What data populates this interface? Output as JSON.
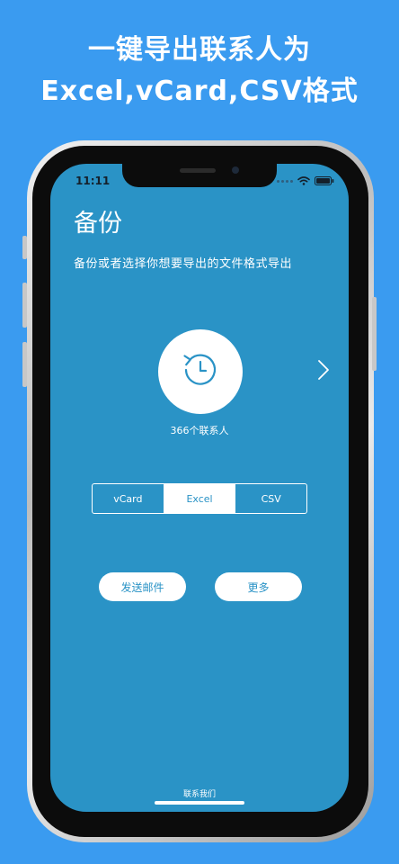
{
  "promo": {
    "line1": "一键导出联系人为",
    "line2": "Excel,vCard,CSV格式"
  },
  "status_bar": {
    "time": "11:11"
  },
  "screen": {
    "title": "备份",
    "subtitle": "备份或者选择你想要导出的文件格式导出",
    "contact_count": "366个联系人",
    "formats": [
      "vCard",
      "Excel",
      "CSV"
    ],
    "selected_format": "Excel",
    "send_email_label": "发送邮件",
    "more_label": "更多",
    "contact_us_label": "联系我们"
  },
  "colors": {
    "page_background": "#3a9bf0",
    "screen_background": "#2a93c6",
    "accent": "#2a93c6"
  },
  "icons": {
    "backup": "history-restore-icon",
    "next": "chevron-right-icon",
    "wifi": "wifi-icon",
    "battery": "battery-icon"
  }
}
